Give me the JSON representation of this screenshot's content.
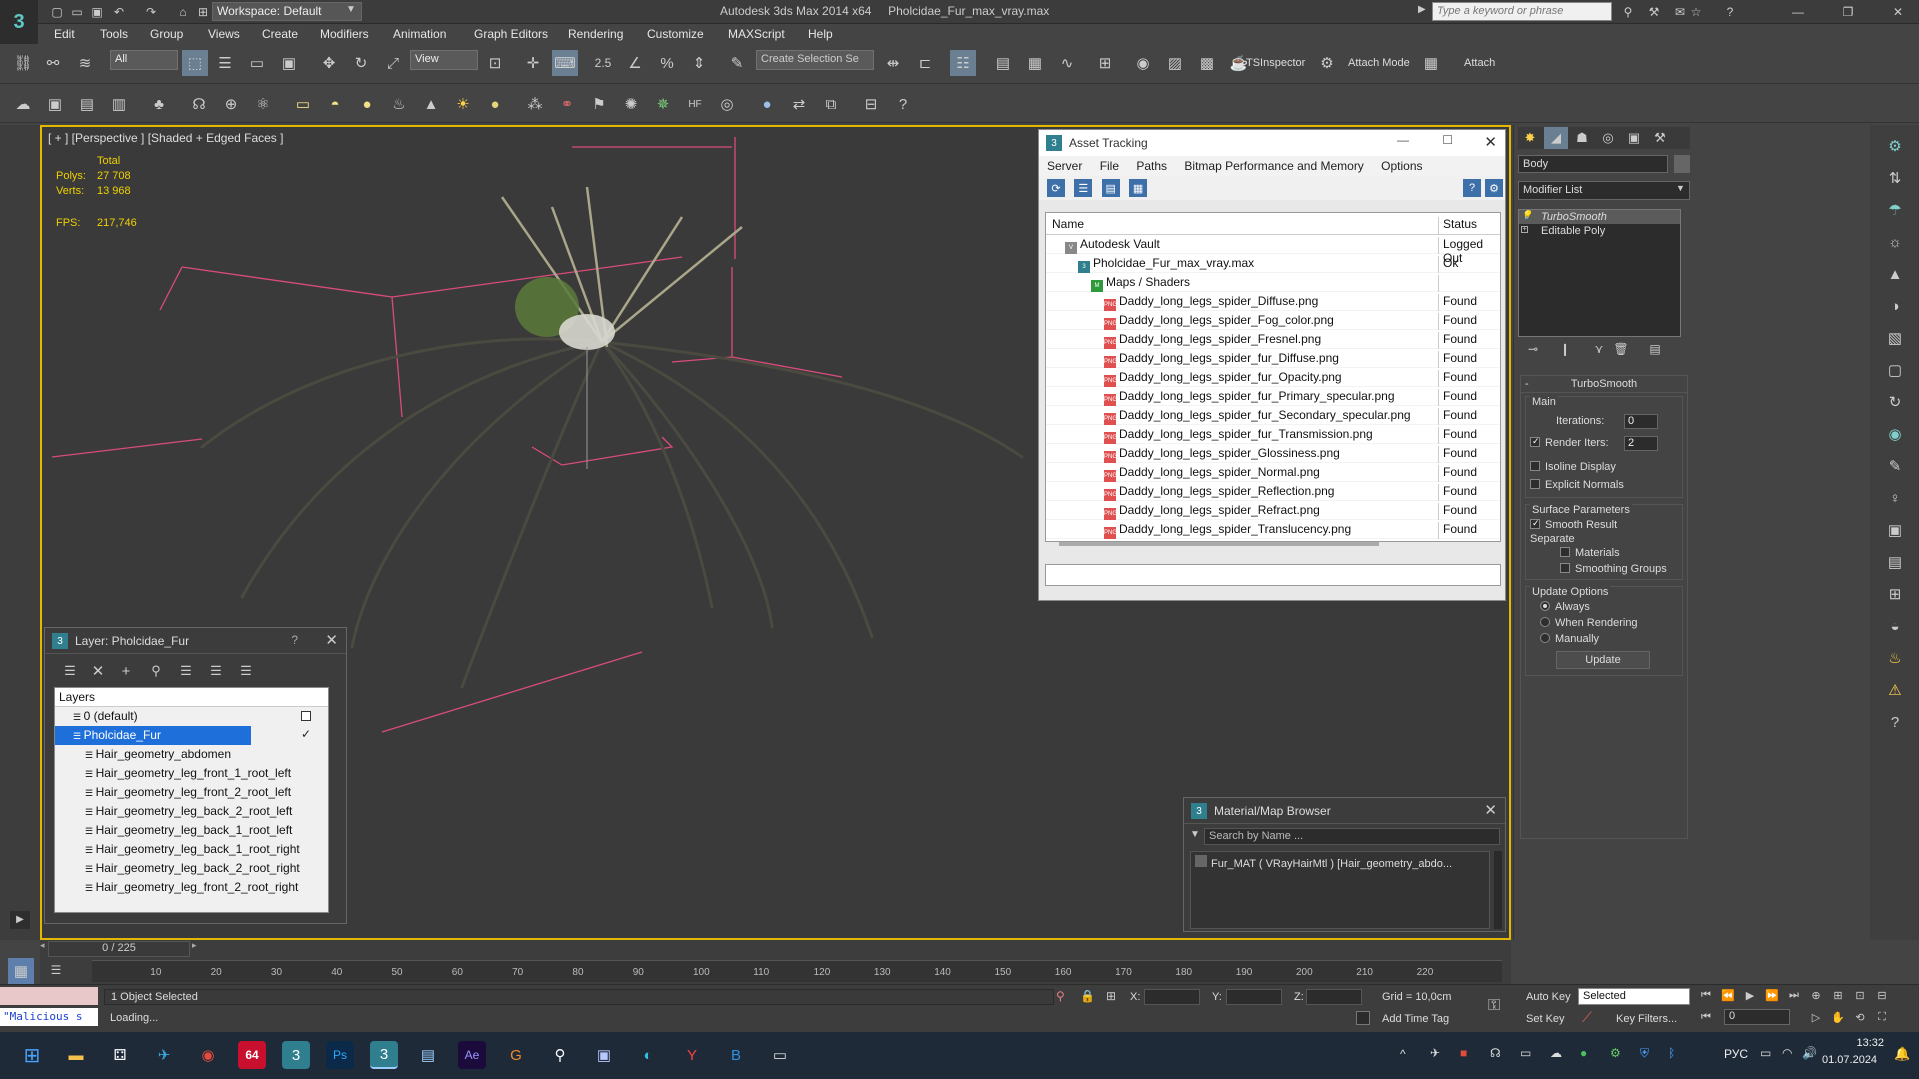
{
  "titlebar": {
    "workspace": "Workspace: Default",
    "app_title": "Autodesk 3ds Max  2014 x64",
    "file_title": "Pholcidae_Fur_max_vray.max",
    "search_placeholder": "Type a keyword or phrase"
  },
  "menu": [
    "Edit",
    "Tools",
    "Group",
    "Views",
    "Create",
    "Modifiers",
    "Animation",
    "Graph Editors",
    "Rendering",
    "Customize",
    "MAXScript",
    "Help"
  ],
  "toolbar": {
    "selection_filter": "All",
    "ref_coord": "View",
    "named_selection": "Create Selection Se",
    "snap_value": "2.5",
    "tsinspector": "TSInspector",
    "attach_mode": "Attach Mode",
    "attach": "Attach"
  },
  "viewport": {
    "label": "[ + ] [Perspective ] [Shaded + Edged Faces ]",
    "total_label": "Total",
    "polys_label": "Polys:",
    "polys_value": "27 708",
    "verts_label": "Verts:",
    "verts_value": "13 968",
    "fps_label": "FPS:",
    "fps_value": "217,746"
  },
  "asset_tracking": {
    "title": "Asset Tracking",
    "menus": [
      "Server",
      "File",
      "Paths",
      "Bitmap Performance and Memory",
      "Options"
    ],
    "col_name": "Name",
    "col_status": "Status",
    "rows": [
      {
        "name": "Autodesk Vault",
        "status": "Logged Out",
        "indent": 1,
        "type": "vault"
      },
      {
        "name": "Pholcidae_Fur_max_vray.max",
        "status": "Ok",
        "indent": 2,
        "type": "max"
      },
      {
        "name": "Maps / Shaders",
        "status": "",
        "indent": 3,
        "type": "maps"
      },
      {
        "name": "Daddy_long_legs_spider_Diffuse.png",
        "status": "Found",
        "indent": 4,
        "type": "png"
      },
      {
        "name": "Daddy_long_legs_spider_Fog_color.png",
        "status": "Found",
        "indent": 4,
        "type": "png"
      },
      {
        "name": "Daddy_long_legs_spider_Fresnel.png",
        "status": "Found",
        "indent": 4,
        "type": "png"
      },
      {
        "name": "Daddy_long_legs_spider_fur_Diffuse.png",
        "status": "Found",
        "indent": 4,
        "type": "png"
      },
      {
        "name": "Daddy_long_legs_spider_fur_Opacity.png",
        "status": "Found",
        "indent": 4,
        "type": "png"
      },
      {
        "name": "Daddy_long_legs_spider_fur_Primary_specular.png",
        "status": "Found",
        "indent": 4,
        "type": "png"
      },
      {
        "name": "Daddy_long_legs_spider_fur_Secondary_specular.png",
        "status": "Found",
        "indent": 4,
        "type": "png"
      },
      {
        "name": "Daddy_long_legs_spider_fur_Transmission.png",
        "status": "Found",
        "indent": 4,
        "type": "png"
      },
      {
        "name": "Daddy_long_legs_spider_Glossiness.png",
        "status": "Found",
        "indent": 4,
        "type": "png"
      },
      {
        "name": "Daddy_long_legs_spider_Normal.png",
        "status": "Found",
        "indent": 4,
        "type": "png"
      },
      {
        "name": "Daddy_long_legs_spider_Reflection.png",
        "status": "Found",
        "indent": 4,
        "type": "png"
      },
      {
        "name": "Daddy_long_legs_spider_Refract.png",
        "status": "Found",
        "indent": 4,
        "type": "png"
      },
      {
        "name": "Daddy_long_legs_spider_Translucency.png",
        "status": "Found",
        "indent": 4,
        "type": "png"
      }
    ]
  },
  "layer_window": {
    "title": "Layer: Pholcidae_Fur",
    "help": "?",
    "header": "Layers",
    "rows": [
      {
        "name": "0 (default)",
        "indent": 1,
        "selected": false
      },
      {
        "name": "Pholcidae_Fur",
        "indent": 1,
        "selected": true
      },
      {
        "name": "Hair_geometry_abdomen",
        "indent": 2,
        "selected": false
      },
      {
        "name": "Hair_geometry_leg_front_1_root_left",
        "indent": 2,
        "selected": false
      },
      {
        "name": "Hair_geometry_leg_front_2_root_left",
        "indent": 2,
        "selected": false
      },
      {
        "name": "Hair_geometry_leg_back_2_root_left",
        "indent": 2,
        "selected": false
      },
      {
        "name": "Hair_geometry_leg_back_1_root_left",
        "indent": 2,
        "selected": false
      },
      {
        "name": "Hair_geometry_leg_back_1_root_right",
        "indent": 2,
        "selected": false
      },
      {
        "name": "Hair_geometry_leg_back_2_root_right",
        "indent": 2,
        "selected": false
      },
      {
        "name": "Hair_geometry_leg_front_2_root_right",
        "indent": 2,
        "selected": false
      }
    ]
  },
  "material_browser": {
    "title": "Material/Map Browser",
    "search_placeholder": "Search by Name ...",
    "item": "Fur_MAT  ( VRayHairMtl )  [Hair_geometry_abdo..."
  },
  "command_panel": {
    "object_name": "Body",
    "modifier_list": "Modifier List",
    "stack": [
      "TurboSmooth",
      "Editable Poly"
    ],
    "rollout_title": "TurboSmooth",
    "main_label": "Main",
    "iterations_label": "Iterations:",
    "iterations_value": "0",
    "render_iters_label": "Render Iters:",
    "render_iters_value": "2",
    "isoline": "Isoline Display",
    "explicit_normals": "Explicit Normals",
    "surface_params": "Surface Parameters",
    "smooth_result": "Smooth Result",
    "separate": "Separate",
    "materials": "Materials",
    "smoothing_groups": "Smoothing Groups",
    "update_options": "Update Options",
    "always": "Always",
    "when_rendering": "When Rendering",
    "manually": "Manually",
    "update_button": "Update"
  },
  "timeline": {
    "frame_counter": "0 / 225",
    "ticks": [
      "10",
      "20",
      "30",
      "40",
      "50",
      "60",
      "70",
      "80",
      "90",
      "100",
      "110",
      "120",
      "130",
      "140",
      "150",
      "160",
      "170",
      "180",
      "190",
      "200",
      "210",
      "220"
    ]
  },
  "status": {
    "maxscript": "\"Malicious s",
    "selected": "1 Object Selected",
    "loading": "Loading...",
    "x_label": "X:",
    "y_label": "Y:",
    "z_label": "Z:",
    "grid": "Grid = 10,0cm",
    "add_time_tag": "Add Time Tag",
    "auto_key": "Auto Key",
    "set_key": "Set Key",
    "key_selected": "Selected",
    "key_filters": "Key Filters...",
    "frame": "0"
  },
  "taskbar": {
    "lang": "РУС",
    "time": "13:32",
    "date": "01.07.2024"
  },
  "colors": {
    "viewport_border": "#e5b800",
    "selection_blue": "#1e6fd9",
    "found_text": "#111111"
  }
}
